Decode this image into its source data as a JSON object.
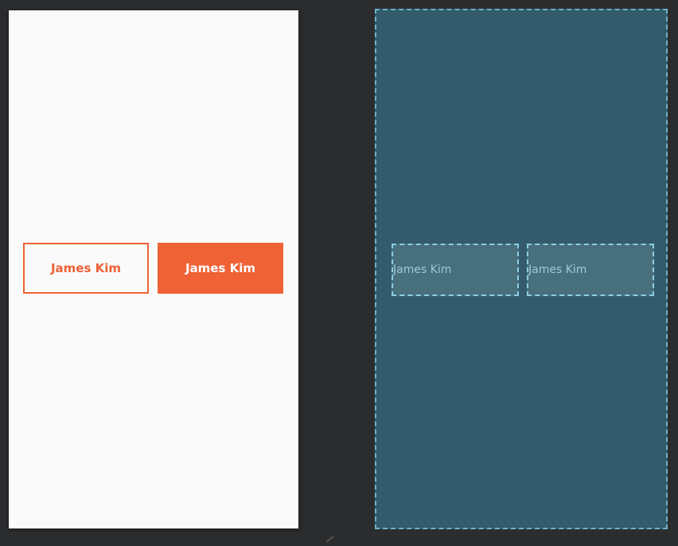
{
  "design": {
    "outlined_button_label": "James Kim",
    "filled_button_label": "James Kim"
  },
  "blueprint": {
    "box1_label": "James Kim",
    "box2_label": "James Kim"
  },
  "colors": {
    "accent": "#ef6236",
    "canvas": "#2b2c2e",
    "blueprint_bg": "#335b6c",
    "blueprint_outline": "#6fb2cc"
  }
}
